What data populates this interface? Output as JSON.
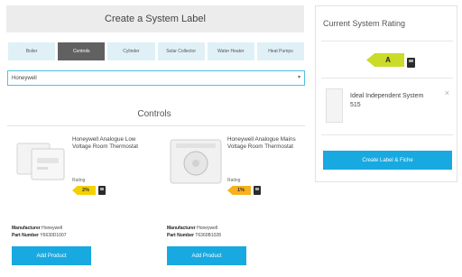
{
  "header": {
    "title": "Create a System Label"
  },
  "tabs": [
    "Boiler",
    "Controls",
    "Cylinder",
    "Solar Collector",
    "Water Heater",
    "Heat Pumps"
  ],
  "filter": {
    "value": "Honeywell"
  },
  "section": {
    "title": "Controls"
  },
  "products": [
    {
      "name": "Honeywell Analogue Low Voltage Room Thermostat",
      "rating_label": "Rating",
      "rating_value": "2%",
      "rating_color": "#f5d000",
      "manufacturer_label": "Manufacturer",
      "manufacturer": "Honeywell",
      "part_label": "Part Number",
      "part": "Y6630D1007",
      "button": "Add Product"
    },
    {
      "name": "Honeywell Analogue Mains Voltage Room Thermostat",
      "rating_label": "Rating",
      "rating_value": "1%",
      "rating_color": "#f8b01e",
      "manufacturer_label": "Manufacturer",
      "manufacturer": "Honeywell",
      "part_label": "Part Number",
      "part": "T6360B1028",
      "button": "Add Product"
    }
  ],
  "sidebar": {
    "title": "Current System Rating",
    "rating": "A",
    "rating_color": "#cadb2a",
    "selected_item": "Ideal Independent System 515",
    "close_symbol": "×",
    "create_button": "Create Label & Fiche"
  }
}
